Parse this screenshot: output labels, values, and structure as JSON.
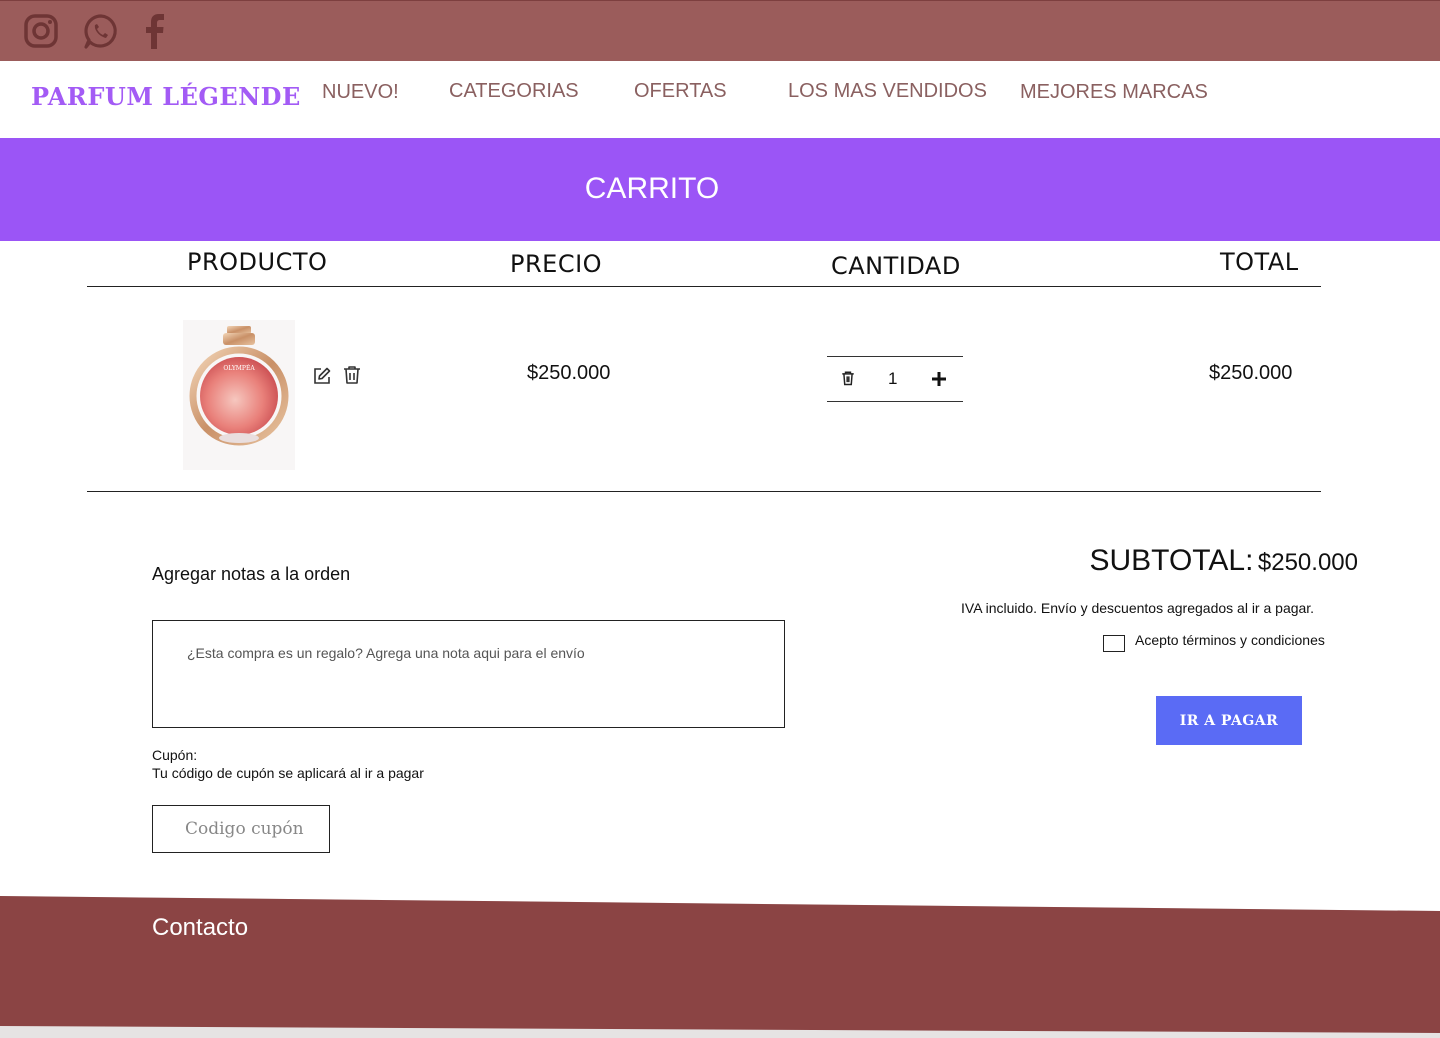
{
  "social": {
    "icons": [
      "instagram-icon",
      "whatsapp-icon",
      "facebook-icon"
    ],
    "bar_color": "#9b5c5b"
  },
  "header": {
    "brand": "PARFUM LÉGENDE",
    "nav": [
      "NUEVO!",
      "CATEGORIAS",
      "OFERTAS",
      "LOS MAS VENDIDOS",
      "MEJORES MARCAS"
    ]
  },
  "banner": {
    "title": "CARRITO",
    "color": "#9b55f6"
  },
  "table": {
    "headers": [
      "PRODUCTO",
      "PRECIO",
      "CANTIDAD",
      "TOTAL"
    ],
    "rows": [
      {
        "product_image": "Olympéa perfume bottle",
        "price": "$250.000",
        "quantity": "1",
        "total": "$250.000"
      }
    ]
  },
  "notes": {
    "label": "Agregar notas a la orden",
    "placeholder": "¿Esta compra es un regalo? Agrega una nota aqui para el envío"
  },
  "coupon": {
    "label": "Cupón:",
    "hint": "Tu código de cupón se aplicará al ir a pagar",
    "placeholder": "Codigo cupón"
  },
  "summary": {
    "subtotal_label": "SUBTOTAL:",
    "subtotal_value": "$250.000",
    "tax_note": "IVA incluido. Envío y descuentos agregados al ir a pagar.",
    "terms_label": "Acepto términos y condiciones",
    "pay_button": "IR A PAGAR",
    "pay_color": "#5a6bf5"
  },
  "footer": {
    "title": "Contacto",
    "color": "#8b4444"
  }
}
